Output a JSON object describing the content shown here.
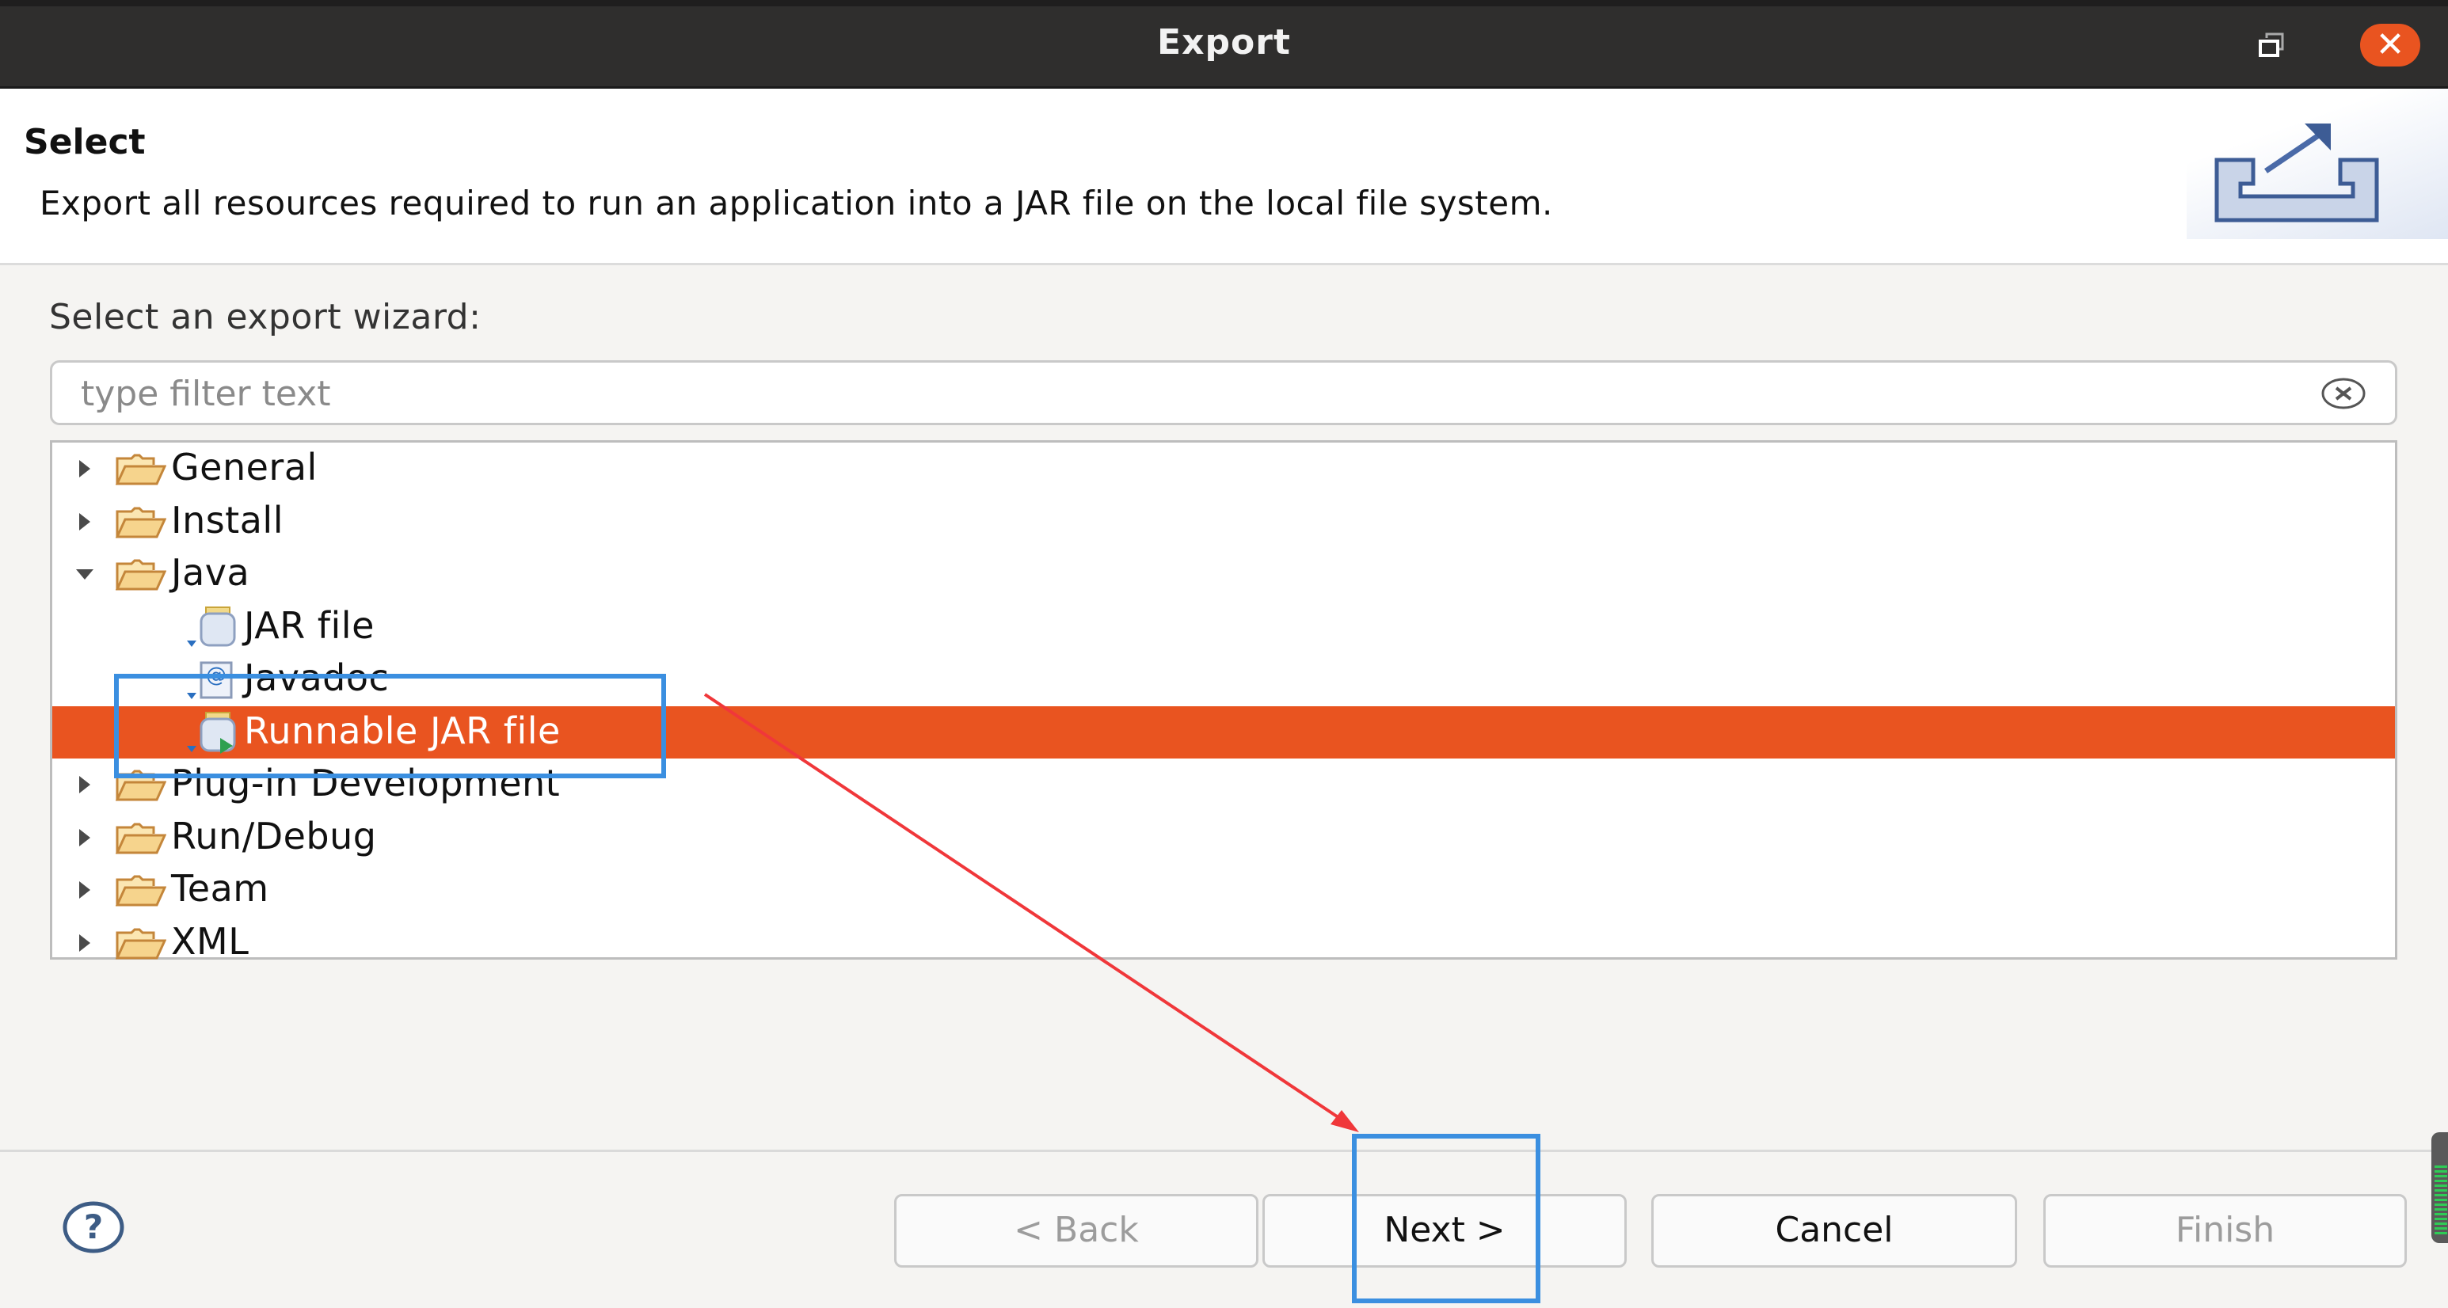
{
  "window": {
    "title": "Export",
    "restore_icon": "restore-window-icon",
    "close_icon": "close-icon",
    "close_symbol": "✕"
  },
  "banner": {
    "heading": "Select",
    "description": "Export all resources required to run an application into a JAR file on the local file system.",
    "icon": "export-wizard-icon"
  },
  "wizard": {
    "label": "Select an export wizard:",
    "filter": {
      "value": "",
      "placeholder": "type filter text",
      "clear_icon": "clear-filter-icon"
    },
    "tree": [
      {
        "label": "General",
        "type": "folder",
        "expanded": false,
        "level": 0
      },
      {
        "label": "Install",
        "type": "folder",
        "expanded": false,
        "level": 0
      },
      {
        "label": "Java",
        "type": "folder",
        "expanded": true,
        "level": 0
      },
      {
        "label": "JAR file",
        "type": "jar",
        "level": 1
      },
      {
        "label": "Javadoc",
        "type": "javadoc",
        "level": 1
      },
      {
        "label": "Runnable JAR file",
        "type": "runnable-jar",
        "level": 1,
        "selected": true
      },
      {
        "label": "Plug-in Development",
        "type": "folder",
        "expanded": false,
        "level": 0
      },
      {
        "label": "Run/Debug",
        "type": "folder",
        "expanded": false,
        "level": 0
      },
      {
        "label": "Team",
        "type": "folder",
        "expanded": false,
        "level": 0
      },
      {
        "label": "XML",
        "type": "folder",
        "expanded": false,
        "level": 0
      }
    ]
  },
  "footer": {
    "help_icon": "help-icon",
    "buttons": {
      "back": {
        "label": "< Back",
        "enabled": false
      },
      "next": {
        "label": "Next >",
        "enabled": true
      },
      "cancel": {
        "label": "Cancel",
        "enabled": true
      },
      "finish": {
        "label": "Finish",
        "enabled": false
      }
    }
  },
  "colors": {
    "titlebar": "#2f2e2d",
    "selection": "#e95420",
    "close_button": "#e95420",
    "annotation_box": "#3b8fe0",
    "annotation_arrow": "#f0373a"
  },
  "annotations": {
    "highlight_targets": [
      "Runnable JAR file",
      "Next >"
    ],
    "arrow": "from Runnable JAR file row to Next > button"
  }
}
